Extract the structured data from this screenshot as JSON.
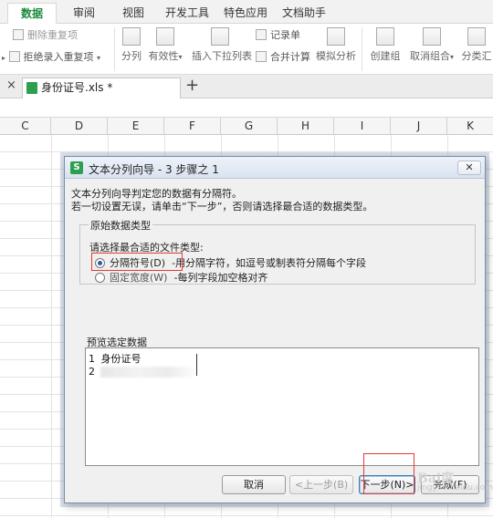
{
  "ribbon_tabs": [
    "数据",
    "审阅",
    "视图",
    "开发工具",
    "特色应用",
    "文档助手"
  ],
  "active_tab": "数据",
  "ribbon": {
    "remove_duplicates": "删除重复项",
    "reject_duplicates": "拒绝录入重复项",
    "split": "分列",
    "validity": "有效性",
    "insert_dropdown": "插入下拉列表",
    "record": "记录单",
    "merge_calc": "合并计算",
    "simulate": "模拟分析",
    "create_group": "创建组",
    "ungroup": "取消组合",
    "subtotal": "分类汇"
  },
  "doc_tab": {
    "close": "×",
    "name": "身份证号.xls *",
    "add": "+"
  },
  "columns": [
    "C",
    "D",
    "E",
    "F",
    "G",
    "H",
    "I",
    "J",
    "K"
  ],
  "dialog": {
    "title": "文本分列向导 - 3 步骤之 1",
    "close": "✕",
    "line1": "文本分列向导判定您的数据有分隔符。",
    "line2": "若一切设置无误，请单击“下一步”，否则请选择最合适的数据类型。",
    "group_title": "原始数据类型",
    "prompt": "请选择最合适的文件类型:",
    "option1_label": "分隔符号(D)",
    "option1_desc": "-用分隔字符，如逗号或制表符分隔每个字段",
    "option2_label": "固定宽度(W)",
    "option2_desc": "-每列字段加空格对齐",
    "preview_title": "预览选定数据",
    "preview_rows": [
      {
        "num": "1",
        "text": "身份证号"
      },
      {
        "num": "2",
        "text": ""
      }
    ],
    "buttons": {
      "cancel": "取消",
      "prev": "<上一步(B)",
      "next": "下一步(N)>",
      "finish": "完成(F)"
    }
  },
  "watermark": {
    "logo": "Bai度",
    "url": "jingyan.baidu.com"
  }
}
